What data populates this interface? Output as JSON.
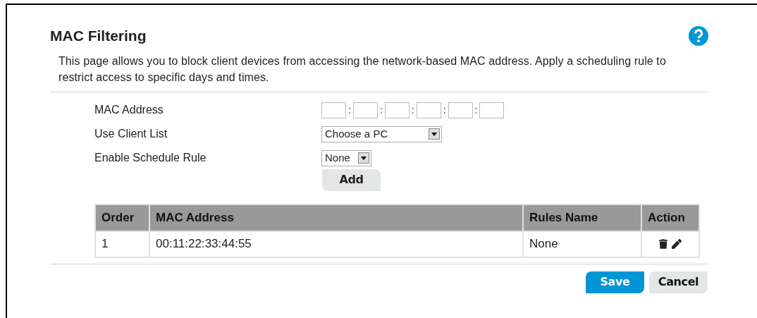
{
  "title": "MAC Filtering",
  "description": "This page allows you to block client devices from accessing the network-based MAC address. Apply a scheduling rule to restrict access to specific days and times.",
  "form": [
    {
      "label": "MAC Address",
      "kind": "mac",
      "separator": ":",
      "octets": [
        {
          "kind": "field"
        },
        {
          "kind": "field"
        },
        {
          "kind": "field"
        },
        {
          "kind": "field"
        },
        {
          "kind": "field"
        },
        {
          "kind": "field"
        }
      ]
    },
    {
      "label": "Use Client List",
      "kind": "select",
      "value": "Choose a PC"
    },
    {
      "label": "Enable Schedule Rule",
      "kind": "select",
      "value": "None"
    }
  ],
  "add_button": "Add",
  "table": {
    "columns": [
      "Order",
      "MAC Address",
      "Rules Name",
      "Action"
    ],
    "rows": [
      {
        "cells": [
          "1",
          "00:11:22:33:44:55",
          "None"
        ],
        "actions": [
          {
            "kind": "delete"
          },
          {
            "kind": "edit"
          }
        ]
      }
    ]
  },
  "buttons": [
    {
      "label": "Save",
      "kind": "primary"
    },
    {
      "label": "Cancel",
      "kind": "secondary"
    }
  ]
}
